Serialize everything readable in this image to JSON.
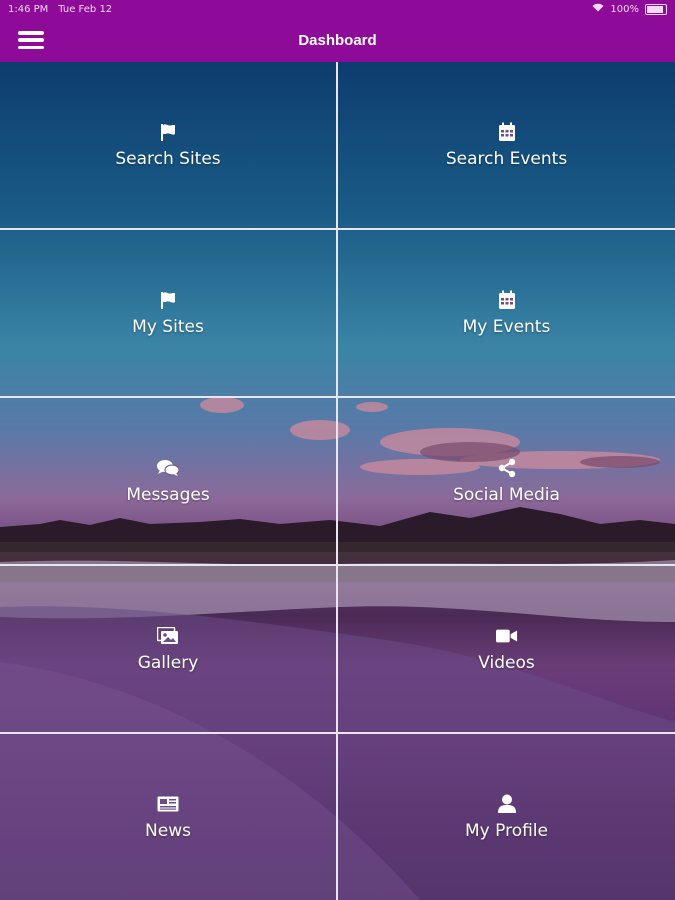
{
  "status_bar": {
    "time": "1:46 PM",
    "date": "Tue Feb 12",
    "battery": "100%"
  },
  "header": {
    "title": "Dashboard"
  },
  "tiles": [
    {
      "label": "Search Sites",
      "icon": "flag-icon"
    },
    {
      "label": "Search Events",
      "icon": "calendar-icon"
    },
    {
      "label": "My Sites",
      "icon": "flag-icon"
    },
    {
      "label": "My Events",
      "icon": "calendar-icon"
    },
    {
      "label": "Messages",
      "icon": "chat-bubbles-icon"
    },
    {
      "label": "Social Media",
      "icon": "share-icon"
    },
    {
      "label": "Gallery",
      "icon": "images-icon"
    },
    {
      "label": "Videos",
      "icon": "video-camera-icon"
    },
    {
      "label": "News",
      "icon": "newspaper-icon"
    },
    {
      "label": "My Profile",
      "icon": "user-icon"
    }
  ],
  "colors": {
    "header_bg": "#8e0a98",
    "divider": "#e9e6ef",
    "text": "#ffffff"
  }
}
